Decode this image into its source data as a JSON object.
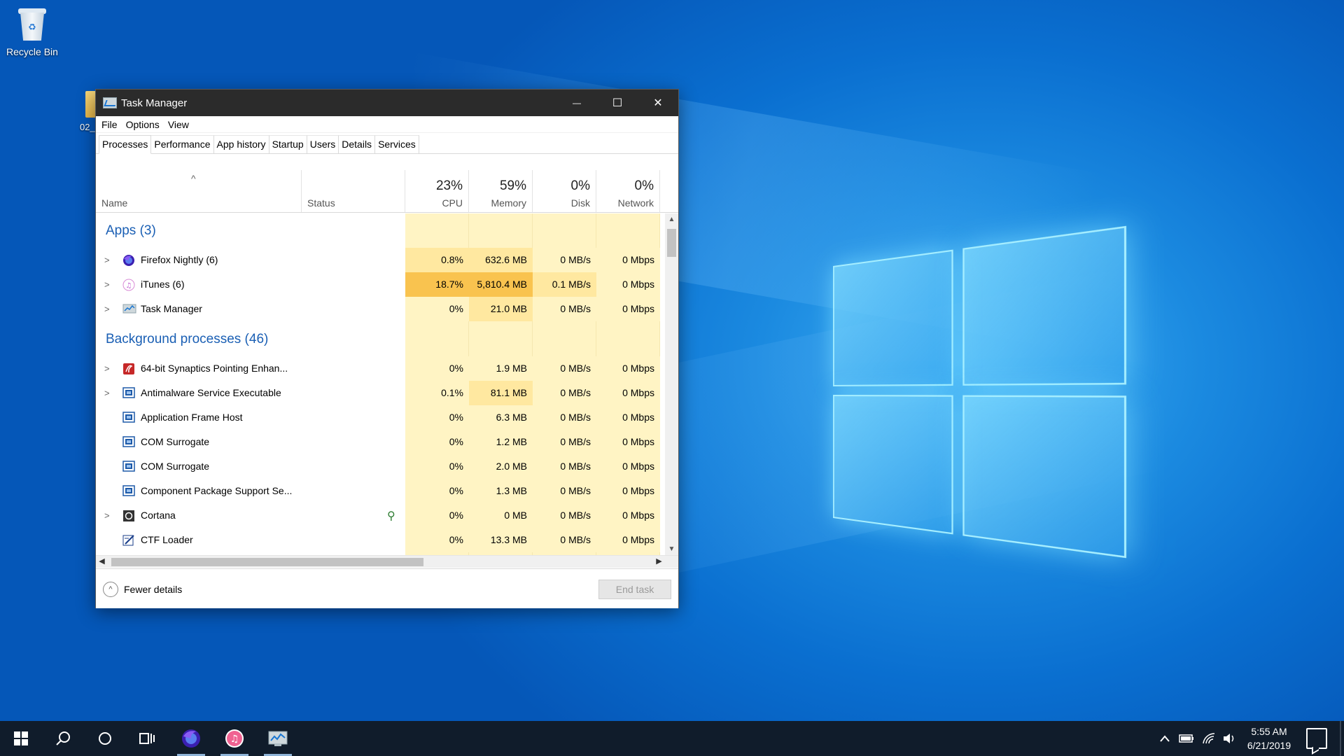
{
  "desktop": {
    "recycle_bin_label": "Recycle Bin",
    "folder_label": "02_"
  },
  "window": {
    "title": "Task Manager",
    "minimize_glyph": "—",
    "maximize_glyph": "☐",
    "close_glyph": "✕"
  },
  "menu": [
    "File",
    "Options",
    "View"
  ],
  "tabs": [
    "Processes",
    "Performance",
    "App history",
    "Startup",
    "Users",
    "Details",
    "Services"
  ],
  "columns": {
    "name": "Name",
    "status": "Status",
    "cpu": {
      "label": "CPU",
      "percent": "23%"
    },
    "memory": {
      "label": "Memory",
      "percent": "59%"
    },
    "disk": {
      "label": "Disk",
      "percent": "0%"
    },
    "network": {
      "label": "Network",
      "percent": "0%"
    },
    "sort_glyph": "^"
  },
  "groups": {
    "apps": "Apps (3)",
    "background": "Background processes (46)"
  },
  "apps": [
    {
      "name": "Firefox Nightly (6)",
      "icon": "firefox-nightly-icon",
      "cpu": "0.8%",
      "memory": "632.6 MB",
      "disk": "0 MB/s",
      "network": "0 Mbps"
    },
    {
      "name": "iTunes (6)",
      "icon": "itunes-icon",
      "cpu": "18.7%",
      "memory": "5,810.4 MB",
      "disk": "0.1 MB/s",
      "network": "0 Mbps"
    },
    {
      "name": "Task Manager",
      "icon": "task-manager-icon",
      "cpu": "0%",
      "memory": "21.0 MB",
      "disk": "0 MB/s",
      "network": "0 Mbps"
    }
  ],
  "background": [
    {
      "name": "64-bit Synaptics Pointing Enhan...",
      "icon": "synaptics-icon",
      "cpu": "0%",
      "memory": "1.9 MB",
      "disk": "0 MB/s",
      "network": "0 Mbps"
    },
    {
      "name": "Antimalware Service Executable",
      "icon": "service-icon",
      "cpu": "0.1%",
      "memory": "81.1 MB",
      "disk": "0 MB/s",
      "network": "0 Mbps"
    },
    {
      "name": "Application Frame Host",
      "icon": "service-icon",
      "cpu": "0%",
      "memory": "6.3 MB",
      "disk": "0 MB/s",
      "network": "0 Mbps"
    },
    {
      "name": "COM Surrogate",
      "icon": "service-icon",
      "cpu": "0%",
      "memory": "1.2 MB",
      "disk": "0 MB/s",
      "network": "0 Mbps"
    },
    {
      "name": "COM Surrogate",
      "icon": "service-icon",
      "cpu": "0%",
      "memory": "2.0 MB",
      "disk": "0 MB/s",
      "network": "0 Mbps"
    },
    {
      "name": "Component Package Support Se...",
      "icon": "service-icon",
      "cpu": "0%",
      "memory": "1.3 MB",
      "disk": "0 MB/s",
      "network": "0 Mbps"
    },
    {
      "name": "Cortana",
      "icon": "cortana-icon",
      "cpu": "0%",
      "memory": "0 MB",
      "disk": "0 MB/s",
      "network": "0 Mbps"
    },
    {
      "name": "CTF Loader",
      "icon": "ctf-loader-icon",
      "cpu": "0%",
      "memory": "13.3 MB",
      "disk": "0 MB/s",
      "network": "0 Mbps"
    }
  ],
  "footer": {
    "fewer_details": "Fewer details",
    "end_task": "End task"
  },
  "taskbar": {
    "time": "5:55 AM",
    "date": "6/21/2019"
  },
  "colors": {
    "heat_light": "#fff4c4",
    "heat_medium": "#ffe8a0",
    "heat_strong": "#ffd36e",
    "heat_max": "#f9c34f",
    "group_text": "#1a5fb4"
  }
}
